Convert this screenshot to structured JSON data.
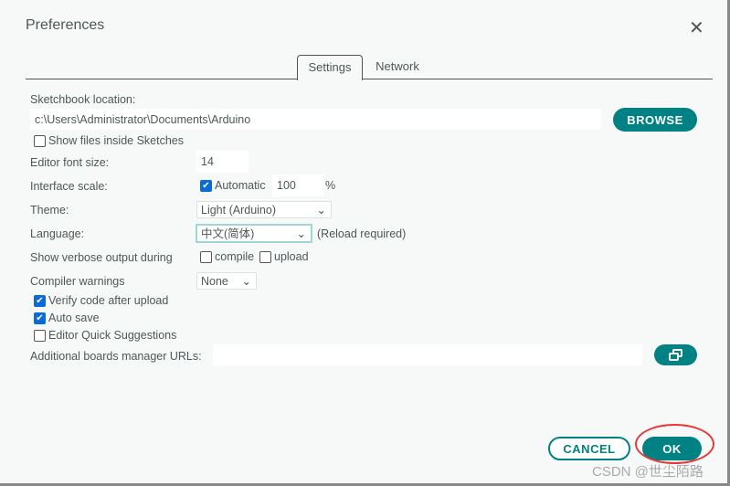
{
  "dialog": {
    "title": "Preferences"
  },
  "tabs": [
    {
      "label": "Settings",
      "active": true
    },
    {
      "label": "Network",
      "active": false
    }
  ],
  "settings": {
    "sketchbook_label": "Sketchbook location:",
    "sketchbook_path": "c:\\Users\\Administrator\\Documents\\Arduino",
    "browse_label": "BROWSE",
    "show_files_label": "Show files inside Sketches",
    "show_files_checked": false,
    "font_size_label": "Editor font size:",
    "font_size": "14",
    "scale_label": "Interface scale:",
    "scale_auto_label": "Automatic",
    "scale_auto_checked": true,
    "scale_value": "100",
    "scale_unit": "%",
    "theme_label": "Theme:",
    "theme_value": "Light (Arduino)",
    "language_label": "Language:",
    "language_value": "中文(简体)",
    "language_note": "(Reload required)",
    "verbose_label": "Show verbose output during",
    "compile_label": "compile",
    "upload_label": "upload",
    "warnings_label": "Compiler warnings",
    "warnings_value": "None",
    "verify_label": "Verify code after upload",
    "verify_checked": true,
    "autosave_label": "Auto save",
    "autosave_checked": true,
    "quick_label": "Editor Quick Suggestions",
    "quick_checked": false,
    "urls_label": "Additional boards manager URLs:",
    "urls_value": ""
  },
  "footer": {
    "cancel_label": "CANCEL",
    "ok_label": "OK"
  },
  "watermark": "CSDN @世尘陌路",
  "colors": {
    "accent": "#008184",
    "highlight": "#e53935"
  }
}
